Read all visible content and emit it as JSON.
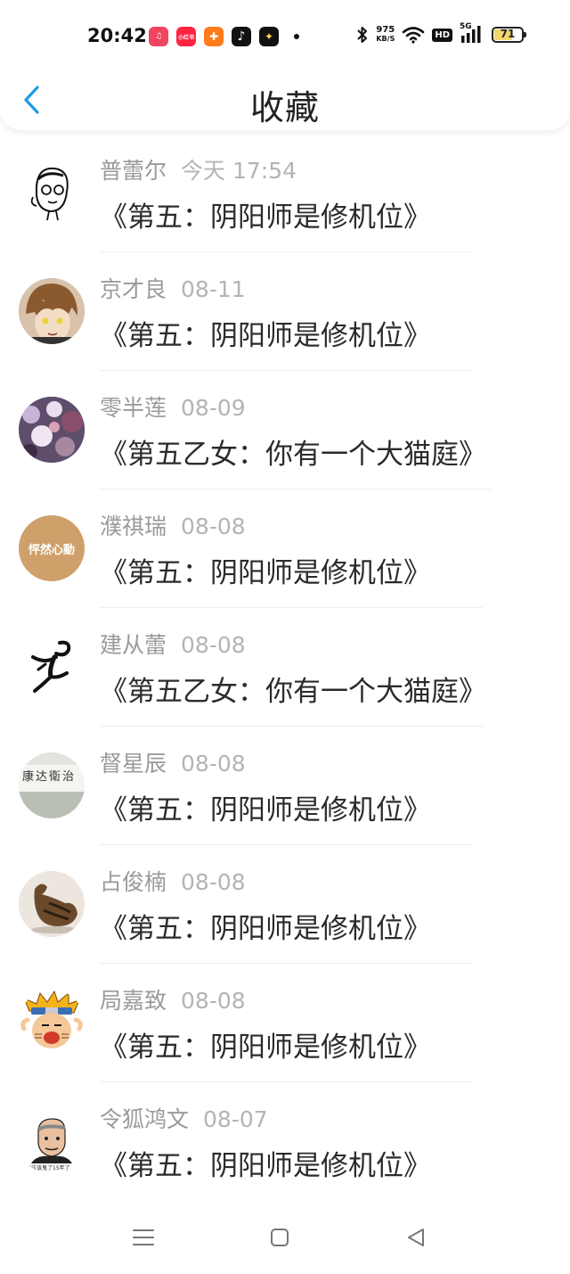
{
  "status_bar": {
    "time": "20:42",
    "apps": [
      {
        "name": "music-app-icon",
        "label": "♫",
        "color": "#f0455f"
      },
      {
        "name": "xiaohongshu-app-icon",
        "label": "小红书",
        "color": "#ff2442"
      },
      {
        "name": "shop-app-icon",
        "label": "✚",
        "color": "#ff7a1a"
      },
      {
        "name": "tiktok-app-icon",
        "label": "♪",
        "color": "#111111"
      },
      {
        "name": "star-app-icon",
        "label": "✦",
        "color": "#111111"
      }
    ],
    "net_speed_value": "975",
    "net_speed_unit": "KB/S",
    "hd_label": "HD",
    "network_label": "5G",
    "battery_level": "71",
    "battery_percent": 71
  },
  "header": {
    "title": "收藏"
  },
  "favorites": [
    {
      "user": "普蕾尔",
      "date": "今天 17:54",
      "title": "《第五：阴阳师是修机位》"
    },
    {
      "user": "京才良",
      "date": "08-11",
      "title": "《第五：阴阳师是修机位》"
    },
    {
      "user": "零半莲",
      "date": "08-09",
      "title": "《第五乙女：你有一个大猫庭》"
    },
    {
      "user": "濮祺瑞",
      "date": "08-08",
      "title": "《第五：阴阳师是修机位》",
      "avatar_text": "怦然心動"
    },
    {
      "user": "建从蕾",
      "date": "08-08",
      "title": "《第五乙女：你有一个大猫庭》"
    },
    {
      "user": "督星辰",
      "date": "08-08",
      "title": "《第五：阴阳师是修机位》",
      "avatar_text": "康达衛治"
    },
    {
      "user": "占俊楠",
      "date": "08-08",
      "title": "《第五：阴阳师是修机位》"
    },
    {
      "user": "局嘉致",
      "date": "08-08",
      "title": "《第五：阴阳师是修机位》"
    },
    {
      "user": "令狐鸿文",
      "date": "08-07",
      "title": "《第五：阴阳师是修机位》",
      "avatar_text": "那我应该鬼了15年了"
    }
  ],
  "colors": {
    "accent": "#1e9be6",
    "meta_text": "#9a9a9a",
    "title_text": "#2b2b2b"
  },
  "nav_bar": {
    "icons": [
      "menu-icon",
      "home-icon",
      "back-triangle-icon"
    ]
  }
}
